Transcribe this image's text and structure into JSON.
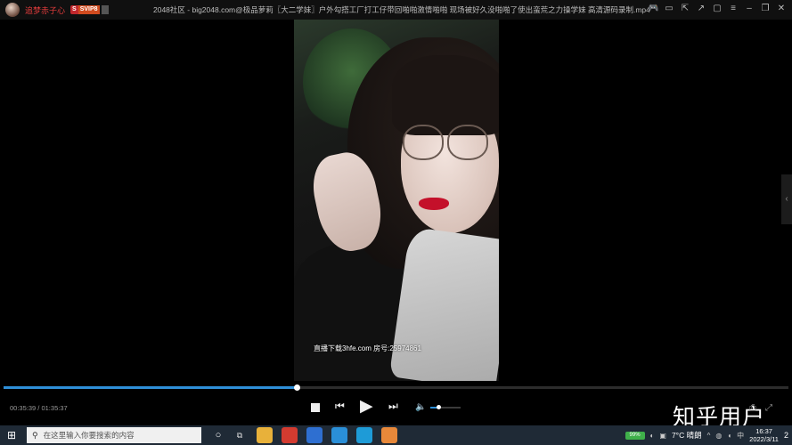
{
  "titlebar": {
    "username": "追梦赤子心",
    "badge_s": "S",
    "badge_text": "SVIP8",
    "file_title": "2048社区 - big2048.com@极品萝莉〖大二学妹〗户外勾搭工厂打工仔带回啪啪激情啪啪 现场被好久没啪啪了使出蛮荒之力操学妹 高清源码录制.mp4",
    "icons": [
      "game-icon",
      "screen-icon",
      "pin-icon",
      "share-icon",
      "folder-icon",
      "menu-icon",
      "minimize-icon",
      "restore-icon",
      "close-icon"
    ]
  },
  "video": {
    "watermark": "直播下载3hfe.com 房号:25974861"
  },
  "player": {
    "current_time": "00:35:39 /",
    "total_time": "01:35:37",
    "progress_fraction": 0.373,
    "volume_fraction": 0.27,
    "accent_color": "#2f8fd8"
  },
  "overlay": {
    "site_watermark": "知乎用户"
  },
  "taskbar": {
    "search_placeholder": "在这里输入你要搜索的内容",
    "weather": "7°C 晴朗",
    "battery_label": "99%",
    "time": "16:37",
    "date": "2022/3/11",
    "notification_count": "2",
    "apps": [
      {
        "name": "task-view-icon",
        "color": "transparent"
      },
      {
        "name": "file-explorer-icon",
        "color": "#e8b13a"
      },
      {
        "name": "chrome-icon",
        "color": "#d33b30"
      },
      {
        "name": "app-blue-icon",
        "color": "#2e6fd1"
      },
      {
        "name": "ie-icon",
        "color": "#2a8fd8"
      },
      {
        "name": "edge-icon",
        "color": "#1e9bd7"
      },
      {
        "name": "player-app-icon",
        "color": "#e7883a"
      }
    ]
  }
}
